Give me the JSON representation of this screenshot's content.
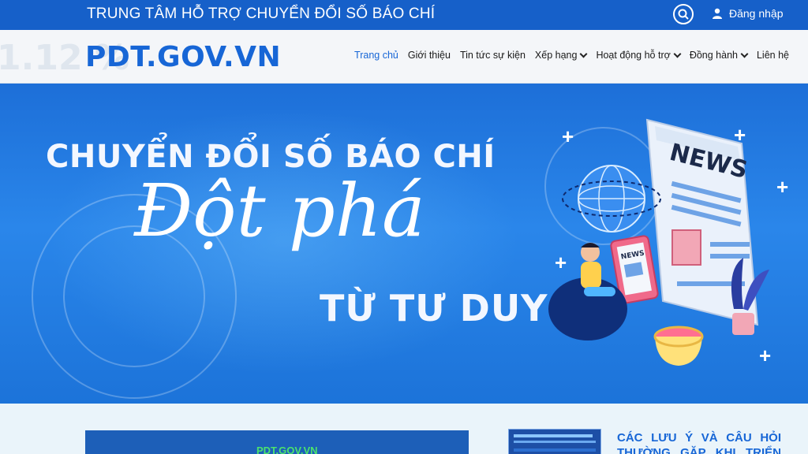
{
  "topbar": {
    "title": "TRUNG TÂM HỖ TRỢ CHUYỂN ĐỔI SỐ BÁO CHÍ",
    "login_label": "Đăng nhập"
  },
  "header": {
    "logo": "PDT.GOV.VN",
    "watermark": "1.12 %"
  },
  "nav": [
    {
      "label": "Trang chủ",
      "has_dropdown": false,
      "active": true
    },
    {
      "label": "Giới thiệu",
      "has_dropdown": false,
      "active": false
    },
    {
      "label": "Tin tức sự kiện",
      "has_dropdown": false,
      "active": false
    },
    {
      "label": "Xếp hạng",
      "has_dropdown": true,
      "active": false
    },
    {
      "label": "Hoạt động hỗ trợ",
      "has_dropdown": true,
      "active": false
    },
    {
      "label": "Đồng hành",
      "has_dropdown": true,
      "active": false
    },
    {
      "label": "Liên hệ",
      "has_dropdown": false,
      "active": false
    }
  ],
  "hero": {
    "line1": "CHUYỂN ĐỔI SỐ BÁO CHÍ",
    "line2": "Đột phá",
    "line3": "TỪ TƯ DUY",
    "newspaper_label": "NEWS",
    "tablet_label": "NEWS"
  },
  "content": {
    "card_label": "PDT.GOV.VN",
    "news_title": "CÁC LƯU Ý VÀ CÂU HỎI THƯỜNG GẶP KHI TRIỂN KHAI"
  },
  "colors": {
    "brand_blue": "#1660c9",
    "logo_blue": "#1766d6",
    "hero_blue": "#2a86ea",
    "accent_green": "#4be26d"
  }
}
